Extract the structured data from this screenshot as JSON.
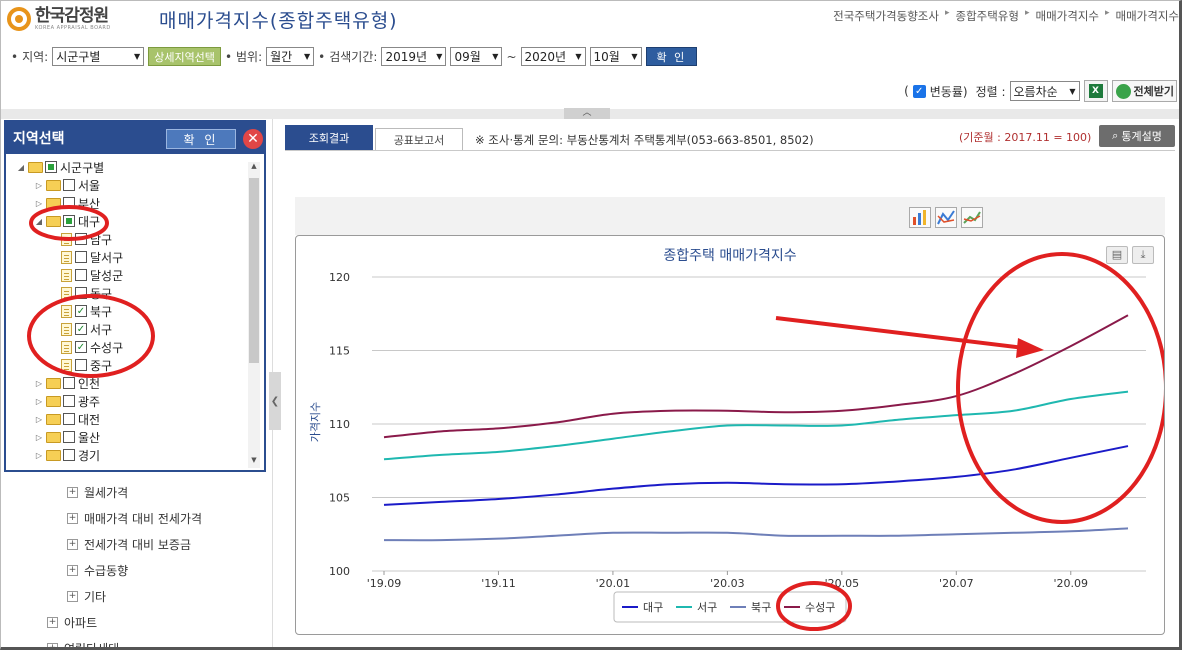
{
  "header": {
    "logo_text": "한국감정원",
    "logo_sub": "KOREA APPRAISAL BOARD",
    "page_title": "매매가격지수(종합주택유형)",
    "breadcrumb": [
      "전국주택가격동향조사",
      "종합주택유형",
      "매매가격지수",
      "매매가격지수"
    ]
  },
  "filters": {
    "region_label": "지역:",
    "region_value": "시군구별",
    "detail_button": "상세지역선택",
    "range_label": "범위:",
    "range_value": "월간",
    "period_label": "검색기간:",
    "start_year": "2019년",
    "start_month": "09월",
    "tilde": "~",
    "end_year": "2020년",
    "end_month": "10월",
    "confirm": "확 인"
  },
  "options": {
    "change_rate_open": "(",
    "change_rate": "변동률)",
    "sort_label": "정렬 :",
    "sort_value": "오름차순",
    "full_download": "전체받기"
  },
  "region_panel": {
    "title": "지역선택",
    "confirm": "확 인",
    "tree": [
      {
        "label": "시군구별",
        "type": "folder",
        "level": 0,
        "state": "partial",
        "expanded": true
      },
      {
        "label": "서울",
        "type": "folder",
        "level": 1,
        "state": "unchecked"
      },
      {
        "label": "부산",
        "type": "folder",
        "level": 1,
        "state": "unchecked"
      },
      {
        "label": "대구",
        "type": "folder",
        "level": 1,
        "state": "partial",
        "expanded": true
      },
      {
        "label": "남구",
        "type": "doc",
        "level": 2,
        "state": "unchecked"
      },
      {
        "label": "달서구",
        "type": "doc",
        "level": 2,
        "state": "unchecked"
      },
      {
        "label": "달성군",
        "type": "doc",
        "level": 2,
        "state": "unchecked"
      },
      {
        "label": "동구",
        "type": "doc",
        "level": 2,
        "state": "unchecked"
      },
      {
        "label": "북구",
        "type": "doc",
        "level": 2,
        "state": "checked"
      },
      {
        "label": "서구",
        "type": "doc",
        "level": 2,
        "state": "checked"
      },
      {
        "label": "수성구",
        "type": "doc",
        "level": 2,
        "state": "checked"
      },
      {
        "label": "중구",
        "type": "doc",
        "level": 2,
        "state": "unchecked"
      },
      {
        "label": "인천",
        "type": "folder",
        "level": 1,
        "state": "unchecked"
      },
      {
        "label": "광주",
        "type": "folder",
        "level": 1,
        "state": "unchecked"
      },
      {
        "label": "대전",
        "type": "folder",
        "level": 1,
        "state": "unchecked"
      },
      {
        "label": "울산",
        "type": "folder",
        "level": 1,
        "state": "unchecked"
      },
      {
        "label": "경기",
        "type": "folder",
        "level": 1,
        "state": "unchecked"
      }
    ]
  },
  "side_menu": [
    {
      "label": "월세가격",
      "level": 2
    },
    {
      "label": "매매가격 대비 전세가격",
      "level": 2
    },
    {
      "label": "전세가격 대비 보증금",
      "level": 2
    },
    {
      "label": "수급동향",
      "level": 2
    },
    {
      "label": "기타",
      "level": 2
    },
    {
      "label": "아파트",
      "level": 1
    },
    {
      "label": "연립다세대",
      "level": 1
    }
  ],
  "tabs": {
    "result": "조회결과",
    "report": "공표보고서"
  },
  "inquiry_note": "※ 조사·통계 문의: 부동산통계처 주택통계부(053-663-8501, 8502)",
  "base_note": "(기준월 : 2017.11 = 100)",
  "stat_button": "통계설명",
  "colors": {
    "brand": "#2b4d8f",
    "annotation": "#e02020"
  },
  "chart_data": {
    "type": "line",
    "title": "종합주택 매매가격지수",
    "ylabel": "가격지수",
    "xlabel": "",
    "ylim": [
      100,
      120
    ],
    "yticks": [
      100,
      105,
      110,
      115,
      120
    ],
    "categories": [
      "'19.09",
      "'19.10",
      "'19.11",
      "'19.12",
      "'20.01",
      "'20.02",
      "'20.03",
      "'20.04",
      "'20.05",
      "'20.06",
      "'20.07",
      "'20.08",
      "'20.09",
      "'20.10"
    ],
    "xtick_labels": [
      "'19.09",
      "'19.11",
      "'20.01",
      "'20.03",
      "'20.05",
      "'20.07",
      "'20.09"
    ],
    "series": [
      {
        "name": "대구",
        "color": "#1b1bc8",
        "values": [
          104.5,
          104.7,
          104.9,
          105.2,
          105.6,
          105.9,
          106.0,
          105.9,
          105.9,
          106.1,
          106.4,
          106.9,
          107.7,
          108.5
        ]
      },
      {
        "name": "서구",
        "color": "#1fb8b0",
        "values": [
          107.6,
          107.9,
          108.1,
          108.5,
          109.0,
          109.5,
          109.9,
          109.9,
          109.9,
          110.3,
          110.6,
          110.9,
          111.7,
          112.2
        ]
      },
      {
        "name": "북구",
        "color": "#6e7fb8",
        "values": [
          102.1,
          102.1,
          102.2,
          102.4,
          102.6,
          102.6,
          102.6,
          102.4,
          102.4,
          102.4,
          102.5,
          102.6,
          102.7,
          102.9
        ]
      },
      {
        "name": "수성구",
        "color": "#8a1a4a",
        "values": [
          109.1,
          109.5,
          109.7,
          110.1,
          110.7,
          110.9,
          110.9,
          110.8,
          110.9,
          111.3,
          111.9,
          113.4,
          115.3,
          117.4
        ]
      }
    ],
    "legend_position": "bottom",
    "grid": true
  }
}
